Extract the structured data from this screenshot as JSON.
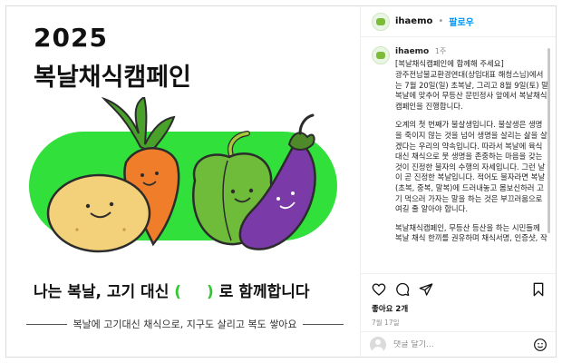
{
  "poster": {
    "year": "2025",
    "title": "복날채식캠페인",
    "tagline_before": "나는 복날,  고기 대신",
    "tagline_open": "(",
    "tagline_close": ")",
    "tagline_after": "로 함께합니다",
    "subline": "복날에 고기대신 채식으로, 지구도 살리고 복도 쌓아요",
    "accent_color": "#31e03a"
  },
  "header": {
    "username": "ihaemo",
    "separator": "•",
    "follow_label": "팔로우"
  },
  "caption": {
    "username": "ihaemo",
    "time": "1주",
    "paragraphs": [
      "[복날채식캠페인에 함께해 주세요]\n광주전남불교환경연대(상임대표 해청스님)에서는 7월 20일(일) 초복날, 그리고 8월 9일(토) 말복날에 맞추어 무등산 문빈정사 앞에서 복날채식캠페인을 진행합니다.",
      "오계의 첫 번째가 불살생입니다. 불살생은 생명을 죽이지 않는 것을 넘어 생명을 살리는 삶을 살겠다는 우리의 약속입니다. 따라서 복날에 육식 대신 채식으로 뭇 생명을 존중하는 마음을 갖는 것이 진정한 불자의 수행의 자세입니다. 그런 날이 곧 진정한 복날입니다. 적어도 불자라면 복날(초복, 중복, 말복)에 드러내놓고 몸보신하러 고기 먹으러 가자는 말을 하는 것은 부끄러움으로 여길 줄 알아야 합니다.",
      "복날채식캠페인, 무등산 등산을 하는 시민들께 복날 채식 한끼를 권유하며 채식서명, 인증샷, 작은 선물 증정(부채)과 걸림 단주"
    ]
  },
  "actions": {
    "likes": "좋아요 2개",
    "date": "7월 17일"
  },
  "comment": {
    "placeholder": "댓글 달기..."
  },
  "icons": {
    "like": "heart-icon",
    "comment": "comment-icon",
    "share": "share-icon",
    "save": "bookmark-icon",
    "emoji": "emoji-icon"
  }
}
